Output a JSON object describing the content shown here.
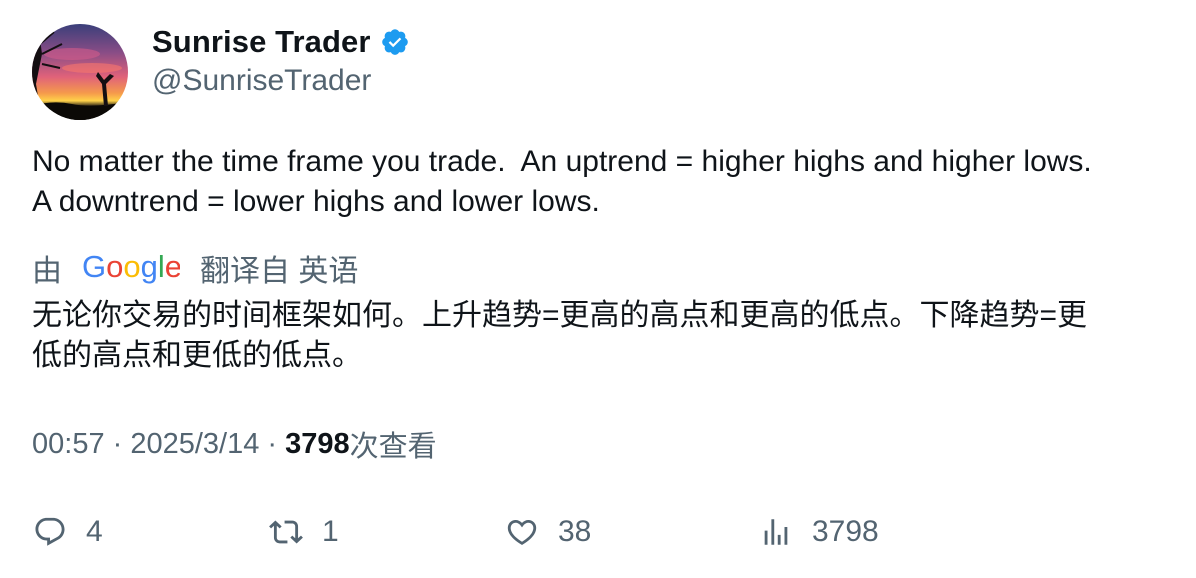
{
  "author": {
    "display_name": "Sunrise Trader",
    "handle": "@SunriseTrader",
    "verified_icon": "verified-badge-icon",
    "verified_color": "#1d9bf0"
  },
  "tweet": {
    "lines": [
      "No matter the time frame you trade.  An uptrend = higher highs and higher lows.",
      "A downtrend = lower highs and lower lows."
    ]
  },
  "translation": {
    "prefix": "由",
    "provider": "Google",
    "suffix": "翻译自 英语",
    "lines": [
      "无论你交易的时间框架如何。上升趋势=更高的高点和更高的低点。下降趋势=更",
      "低的高点和更低的低点。"
    ]
  },
  "meta": {
    "time": "00:57",
    "separator": " · ",
    "date": "2025/3/14",
    "views_count": "3798",
    "views_label": "次查看"
  },
  "actions": {
    "replies": "4",
    "reposts": "1",
    "likes": "38",
    "views": "3798"
  }
}
